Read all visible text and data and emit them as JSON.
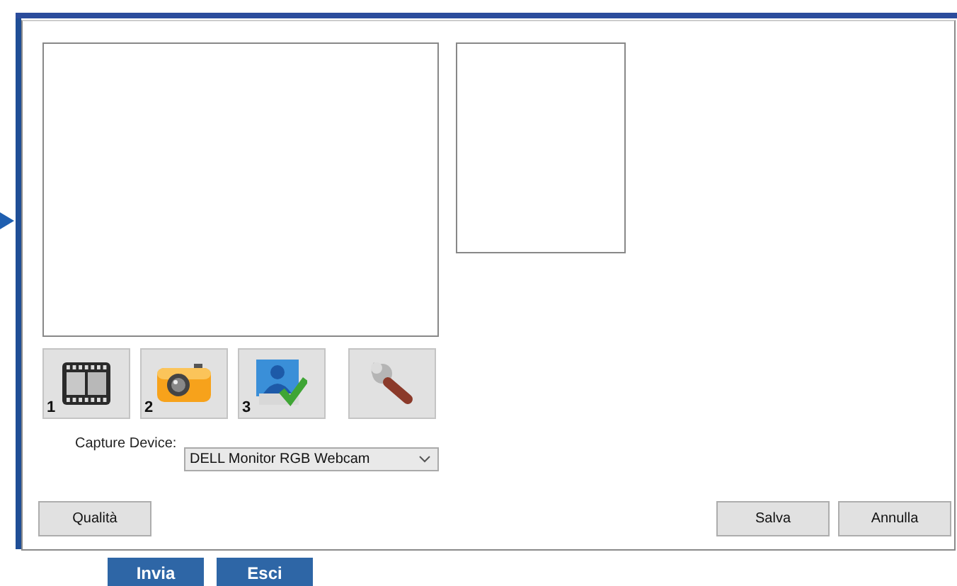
{
  "tool_buttons": [
    {
      "kind": "film",
      "number": "1"
    },
    {
      "kind": "camera",
      "number": "2"
    },
    {
      "kind": "user-check",
      "number": "3"
    },
    {
      "kind": "wrench"
    }
  ],
  "capture_device": {
    "label": "Capture Device:",
    "value": "DELL Monitor RGB Webcam"
  },
  "dialog_buttons_left": [
    "Qualità"
  ],
  "dialog_buttons_right": [
    "Salva",
    "Annulla"
  ],
  "page_buttons": [
    "Invia",
    "Esci"
  ]
}
